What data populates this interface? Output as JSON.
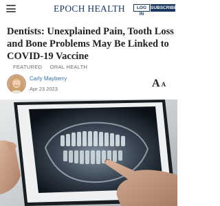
{
  "header": {
    "logo": "EPOCH HEALTH",
    "login_label": "LOG IN",
    "subscribe_label": "SUBSCRIBE",
    "menu_icon": "hamburger-menu-icon"
  },
  "article": {
    "title": "Dentists: Unexplained Pain, Tooth Loss and Bone Problems May Be Linked to COVID-19 Vaccine",
    "categories": [
      "FEATURED",
      "ORAL HEALTH"
    ],
    "author": "Carly Mayberry",
    "date": "Apr 23 2023",
    "font_size_control": {
      "large": "A",
      "small": "A"
    }
  },
  "hero_image": {
    "subject": "dental panoramic x-ray on a tablet screen with a hand pointing"
  },
  "colors": {
    "brand": "#19385e",
    "author_link": "#3a6fa8",
    "muted": "#6a6a6a"
  }
}
